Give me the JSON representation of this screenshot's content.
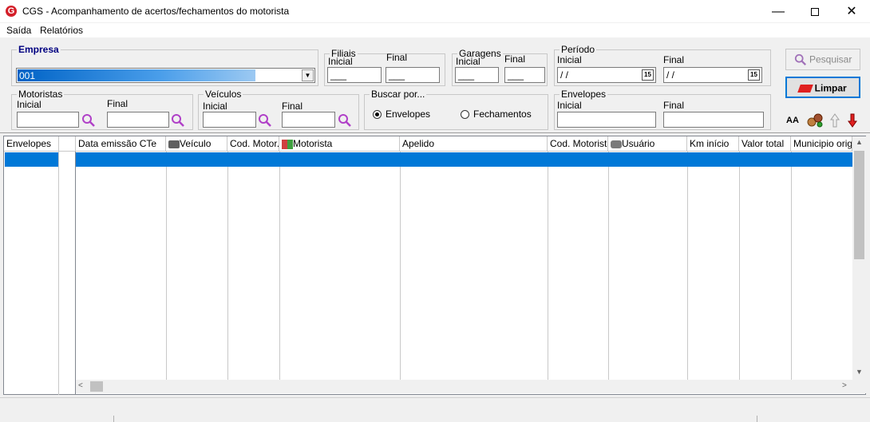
{
  "window": {
    "title": "CGS - Acompanhamento de acertos/fechamentos do motorista",
    "logo_letter": "G"
  },
  "menu": [
    "Saída",
    "Relatórios"
  ],
  "empresa": {
    "legend": "Empresa",
    "value": "001"
  },
  "filiais": {
    "legend": "Filiais",
    "inicial_label": "Inicial",
    "final_label": "Final",
    "inicial_value": "___",
    "final_value": "___"
  },
  "garagens": {
    "legend": "Garagens",
    "inicial_label": "Inicial",
    "final_label": "Final",
    "inicial_value": "___",
    "final_value": "___"
  },
  "periodo": {
    "legend": "Período",
    "inicial_label": "Inicial",
    "final_label": "Final",
    "inicial_value": " / /",
    "final_value": " / /",
    "cal_label": "15"
  },
  "motoristas": {
    "legend": "Motoristas",
    "inicial_label": "Inicial",
    "final_label": "Final"
  },
  "veiculos": {
    "legend": "Veículos",
    "inicial_label": "Inicial",
    "final_label": "Final"
  },
  "buscar": {
    "legend": "Buscar por...",
    "options": [
      "Envelopes",
      "Fechamentos"
    ],
    "selected": "Envelopes"
  },
  "envelopes": {
    "legend": "Envelopes",
    "inicial_label": "Inicial",
    "final_label": "Final"
  },
  "buttons": {
    "pesquisar": "Pesquisar",
    "limpar": "Limpar",
    "font_icon_label": "AA"
  },
  "left_grid": {
    "header": "Envelopes"
  },
  "grid": {
    "columns": [
      "Data emissão CTe",
      "Veículo",
      "Cod. Motor...",
      "Motorista",
      "Apelido",
      "Cod. Motorista",
      "Usuário",
      "Km início",
      "Valor total",
      "Municipio origem"
    ]
  }
}
